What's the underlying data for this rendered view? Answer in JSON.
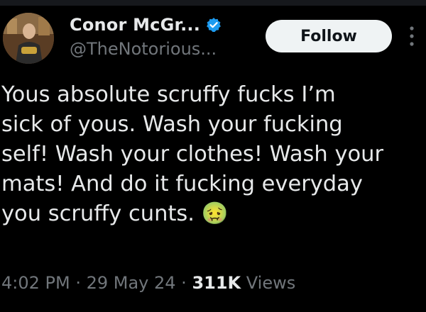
{
  "tweet": {
    "author": {
      "display_name": "Conor McGr...",
      "handle": "@TheNotorious...",
      "verified_icon": "verified-badge-icon",
      "avatar_icon": "profile-photo"
    },
    "follow_label": "Follow",
    "more_icon": "more-options-icon",
    "text": "Yous absolute scruffy fucks I’m\nsick of yous. Wash your fucking\nself! Wash your clothes! Wash your\nmats! And do it fucking everyday\nyou scruffy cunts. ",
    "emoji": "🤢",
    "meta": {
      "time": "4:02 PM",
      "separator": " · ",
      "date": "29 May 24",
      "views_count": "311K",
      "views_label": "Views"
    }
  },
  "colors": {
    "background": "#000000",
    "text_primary": "#e7e9ea",
    "text_secondary": "#71767b",
    "verified_blue": "#1d9bf0",
    "follow_bg": "#eff3f4"
  }
}
